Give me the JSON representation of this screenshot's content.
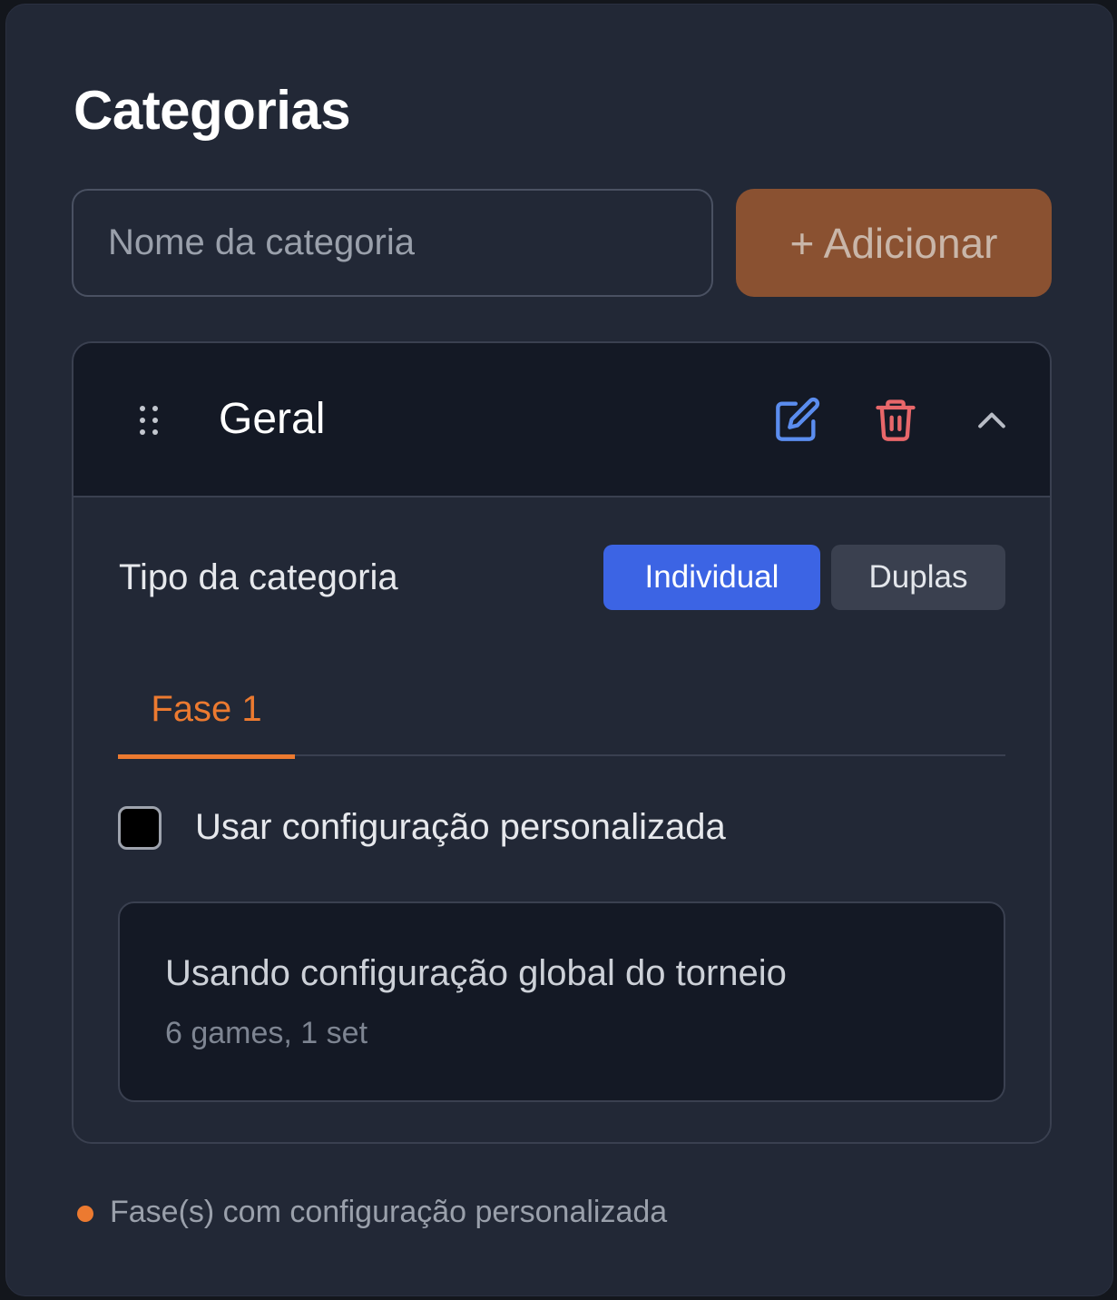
{
  "section": {
    "title": "Categorias"
  },
  "new_category": {
    "placeholder": "Nome da categoria",
    "value": "",
    "add_label": "+ Adicionar"
  },
  "category": {
    "name": "Geral",
    "icons": {
      "drag": "drag-handle-icon",
      "edit": "edit-icon",
      "delete": "trash-icon",
      "collapse": "chevron-up-icon"
    },
    "type_label": "Tipo da categoria",
    "type_options": [
      "Individual",
      "Duplas"
    ],
    "type_selected": "Individual",
    "phase_tabs": [
      "Fase 1"
    ],
    "active_phase": "Fase 1",
    "custom_config_label": "Usar configuração personalizada",
    "custom_config_checked": false,
    "global_config": {
      "title": "Usando configuração global do torneio",
      "details": "6 games, 1 set"
    }
  },
  "legend": {
    "text": "Fase(s) com configuração personalizada"
  },
  "colors": {
    "accent": "#ec7a30",
    "primary_button": "#3c64e4",
    "add_button": "#8a5131",
    "edit_icon": "#5b8def",
    "delete_icon": "#e8676a",
    "background": "#222836"
  }
}
